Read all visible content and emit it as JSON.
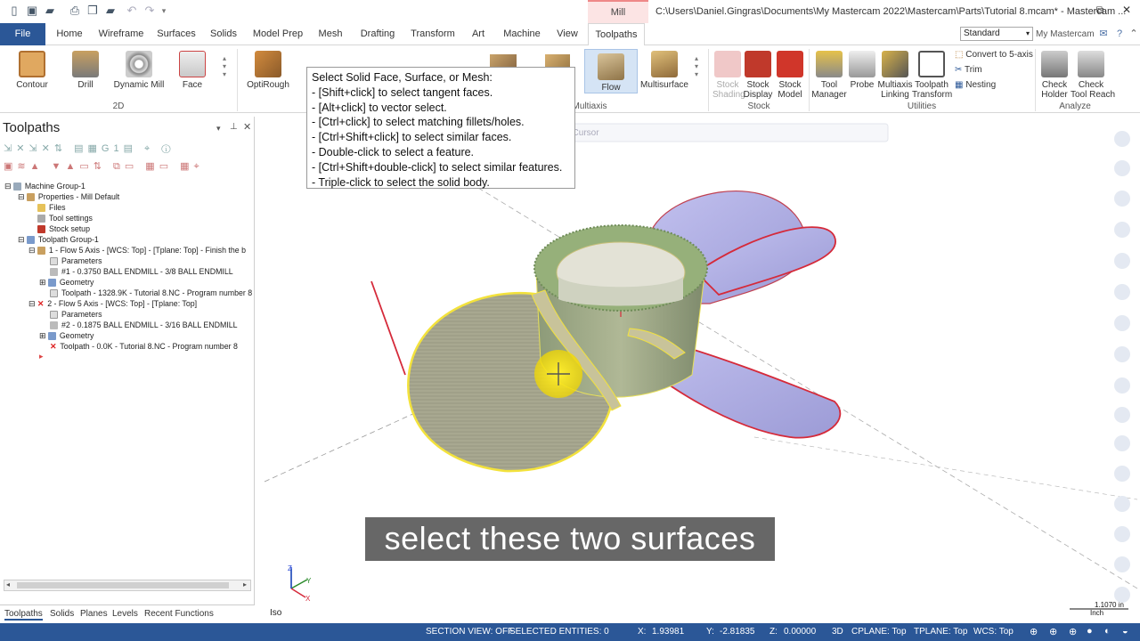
{
  "titlebar": {
    "context_tab": "Mill",
    "window_title": "C:\\Users\\Daniel.Gingras\\Documents\\My Mastercam 2022\\Mastercam\\Parts\\Tutorial 8.mcam* - Mastercam ..."
  },
  "tabs": [
    "File",
    "Home",
    "Wireframe",
    "Surfaces",
    "Solids",
    "Model Prep",
    "Mesh",
    "Drafting",
    "Transform",
    "Art",
    "Machine",
    "View",
    "Toolpaths"
  ],
  "toolbar": {
    "standard": "Standard",
    "my_mastercam": "My Mastercam"
  },
  "ribbon": {
    "buttons": {
      "contour": "Contour",
      "drill": "Drill",
      "dynamic_mill": "Dynamic Mill",
      "face": "Face",
      "optirough": "OptiRough",
      "flow": "Flow",
      "multisurface": "Multisurface",
      "stock_shading": "Stock\nShading",
      "stock_display": "Stock\nDisplay",
      "stock_model": "Stock\nModel",
      "tool_manager": "Tool\nManager",
      "probe": "Probe",
      "multiaxis_linking": "Multiaxis\nLinking",
      "toolpath_transform": "Toolpath\nTransform",
      "convert_5axis": "Convert to 5-axis",
      "trim": "Trim",
      "nesting": "Nesting",
      "check_holder": "Check\nHolder",
      "check_tool_reach": "Check\nTool Reach"
    },
    "groups": {
      "g2d": "2D",
      "multiaxis": "Multiaxis",
      "stock": "Stock",
      "utilities": "Utilities",
      "analyze": "Analyze"
    }
  },
  "tooltip": {
    "lines": [
      "Select Solid Face, Surface, or Mesh:",
      "- [Shift+click] to select tangent faces.",
      "- [Alt+click] to vector select.",
      "- [Ctrl+click] to select matching fillets/holes.",
      "- [Ctrl+Shift+click] to select similar faces.",
      "- Double-click to select a feature.",
      "- [Ctrl+Shift+double-click] to select similar features.",
      "- Triple-click to select the solid body."
    ]
  },
  "panel": {
    "title": "Toolpaths",
    "tree": [
      "Machine Group-1",
      "Properties - Mill Default",
      "Files",
      "Tool settings",
      "Stock setup",
      "Toolpath Group-1",
      "1 - Flow 5 Axis - [WCS: Top] - [Tplane: Top] - Finish the b",
      "Parameters",
      "#1 - 0.3750 BALL ENDMILL - 3/8 BALL ENDMILL",
      "Geometry",
      "Toolpath - 1328.9K - Tutorial 8.NC - Program number 8",
      "2 - Flow 5 Axis - [WCS: Top] - [Tplane: Top]",
      "Parameters",
      "#2 - 0.1875 BALL ENDMILL - 3/16 BALL ENDMILL",
      "Geometry",
      "Toolpath - 0.0K - Tutorial 8.NC - Program number 8"
    ]
  },
  "bottom_tabs": [
    "Toolpaths",
    "Solids",
    "Planes",
    "Levels",
    "Recent Functions"
  ],
  "viewport": {
    "view_label": "Iso",
    "caption": "select these two surfaces",
    "scale_value": "1.1070 in",
    "scale_unit": "Inch",
    "snap_hint": "oCursor",
    "axes": {
      "x": "X",
      "y": "Y",
      "z": "Z"
    }
  },
  "status": {
    "section_view": "SECTION VIEW: OFF",
    "selected": "SELECTED ENTITIES: 0",
    "x_label": "X:",
    "x": "1.93981",
    "y_label": "Y:",
    "y": "-2.81835",
    "z_label": "Z:",
    "z": "0.00000",
    "mode": "3D",
    "cplane": "CPLANE: Top",
    "tplane": "TPLANE: Top",
    "wcs": "WCS: Top"
  },
  "colors": {
    "accent": "#2b5797",
    "surface_face": "#a9a8dc",
    "edge": "#e0202a",
    "selected_face": "#a8a890",
    "cursor": "#f7e000"
  }
}
